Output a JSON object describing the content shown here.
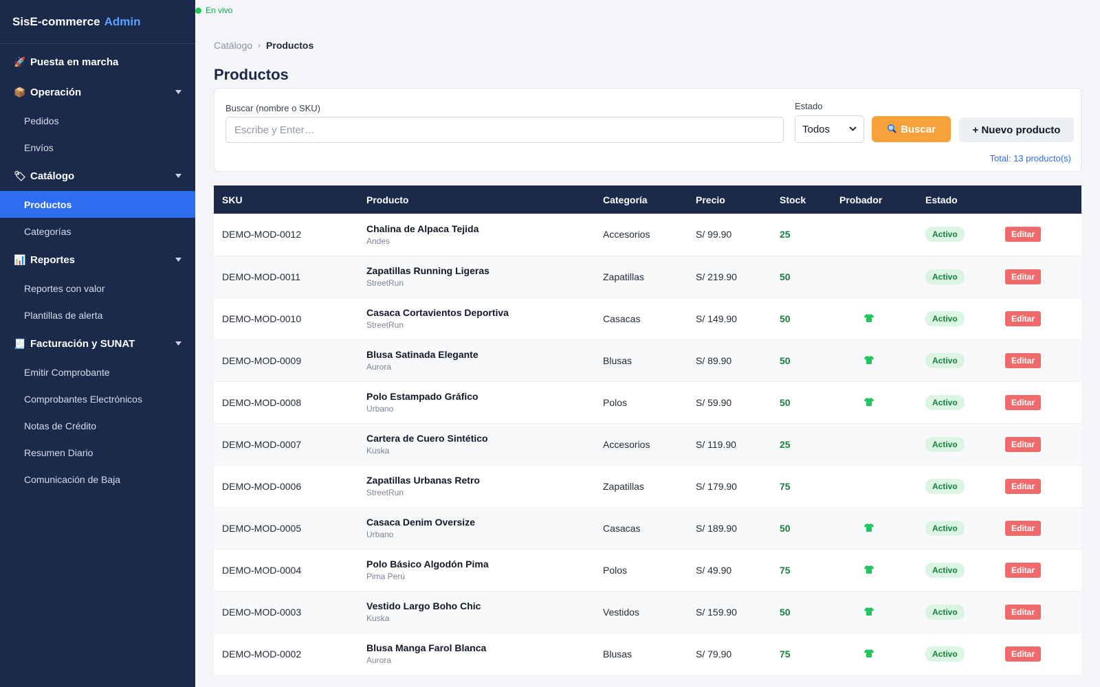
{
  "brand": {
    "name": "SisE-commerce",
    "suffix": "Admin"
  },
  "status": {
    "live": "En vivo"
  },
  "sidebar": {
    "items": [
      {
        "type": "section",
        "label": "Puesta en marcha",
        "icon": "rocket-icon",
        "glyph": "🚀",
        "caret": false
      },
      {
        "type": "section",
        "label": "Operación",
        "icon": "package-icon",
        "glyph": "📦",
        "caret": true
      },
      {
        "type": "item",
        "label": "Pedidos"
      },
      {
        "type": "item",
        "label": "Envíos"
      },
      {
        "type": "section",
        "label": "Catálogo",
        "icon": "tag-icon",
        "glyph": "🏷",
        "caret": true
      },
      {
        "type": "item",
        "label": "Productos",
        "active": true
      },
      {
        "type": "item",
        "label": "Categorías"
      },
      {
        "type": "section",
        "label": "Reportes",
        "icon": "bar-chart-icon",
        "glyph": "📊",
        "caret": true
      },
      {
        "type": "item",
        "label": "Reportes con valor"
      },
      {
        "type": "item",
        "label": "Plantillas de alerta"
      },
      {
        "type": "section",
        "label": "Facturación y SUNAT",
        "icon": "receipt-icon",
        "glyph": "🧾",
        "caret": true
      },
      {
        "type": "item",
        "label": "Emitir Comprobante"
      },
      {
        "type": "item",
        "label": "Comprobantes Electrónicos"
      },
      {
        "type": "item",
        "label": "Notas de Crédito"
      },
      {
        "type": "item",
        "label": "Resumen Diario"
      },
      {
        "type": "item",
        "label": "Comunicación de Baja"
      }
    ]
  },
  "breadcrumb": {
    "parent": "Catálogo",
    "separator": "›",
    "current": "Productos"
  },
  "page": {
    "title": "Productos"
  },
  "filters": {
    "search_label": "Buscar (nombre o SKU)",
    "search_value": "",
    "search_placeholder": "Escribe y Enter…",
    "estado_label": "Estado",
    "estado_value": "Todos",
    "buscar_label": "Buscar",
    "nuevo_label": "+ Nuevo producto",
    "total": "Total: 13 producto(s)"
  },
  "table": {
    "columns": [
      "SKU",
      "Producto",
      "Categoría",
      "Precio",
      "Stock",
      "Probador",
      "Estado",
      ""
    ],
    "rows": [
      {
        "sku": "DEMO-MOD-0012",
        "name": "Chalina de Alpaca Tejida",
        "brand": "Andes",
        "category": "Accesorios",
        "price": "S/ 99.90",
        "stock": "25",
        "probador": false,
        "estado": "Activo",
        "action": "Editar"
      },
      {
        "sku": "DEMO-MOD-0011",
        "name": "Zapatillas Running Ligeras",
        "brand": "StreetRun",
        "category": "Zapatillas",
        "price": "S/ 219.90",
        "stock": "50",
        "probador": false,
        "estado": "Activo",
        "action": "Editar"
      },
      {
        "sku": "DEMO-MOD-0010",
        "name": "Casaca Cortavientos Deportiva",
        "brand": "StreetRun",
        "category": "Casacas",
        "price": "S/ 149.90",
        "stock": "50",
        "probador": true,
        "estado": "Activo",
        "action": "Editar"
      },
      {
        "sku": "DEMO-MOD-0009",
        "name": "Blusa Satinada Elegante",
        "brand": "Aurora",
        "category": "Blusas",
        "price": "S/ 89.90",
        "stock": "50",
        "probador": true,
        "estado": "Activo",
        "action": "Editar"
      },
      {
        "sku": "DEMO-MOD-0008",
        "name": "Polo Estampado Gráfico",
        "brand": "Urbano",
        "category": "Polos",
        "price": "S/ 59.90",
        "stock": "50",
        "probador": true,
        "estado": "Activo",
        "action": "Editar"
      },
      {
        "sku": "DEMO-MOD-0007",
        "name": "Cartera de Cuero Sintético",
        "brand": "Kuska",
        "category": "Accesorios",
        "price": "S/ 119.90",
        "stock": "25",
        "probador": false,
        "estado": "Activo",
        "action": "Editar"
      },
      {
        "sku": "DEMO-MOD-0006",
        "name": "Zapatillas Urbanas Retro",
        "brand": "StreetRun",
        "category": "Zapatillas",
        "price": "S/ 179.90",
        "stock": "75",
        "probador": false,
        "estado": "Activo",
        "action": "Editar"
      },
      {
        "sku": "DEMO-MOD-0005",
        "name": "Casaca Denim Oversize",
        "brand": "Urbano",
        "category": "Casacas",
        "price": "S/ 189.90",
        "stock": "50",
        "probador": true,
        "estado": "Activo",
        "action": "Editar"
      },
      {
        "sku": "DEMO-MOD-0004",
        "name": "Polo Básico Algodón Pima",
        "brand": "Pima Perú",
        "category": "Polos",
        "price": "S/ 49.90",
        "stock": "75",
        "probador": true,
        "estado": "Activo",
        "action": "Editar"
      },
      {
        "sku": "DEMO-MOD-0003",
        "name": "Vestido Largo Boho Chic",
        "brand": "Kuska",
        "category": "Vestidos",
        "price": "S/ 159.90",
        "stock": "50",
        "probador": true,
        "estado": "Activo",
        "action": "Editar"
      },
      {
        "sku": "DEMO-MOD-0002",
        "name": "Blusa Manga Farol Blanca",
        "brand": "Aurora",
        "category": "Blusas",
        "price": "S/ 79.90",
        "stock": "75",
        "probador": true,
        "estado": "Activo",
        "action": "Editar"
      }
    ]
  },
  "colors": {
    "sidebar": "#1b2a4a",
    "accent": "#2c6df1",
    "buscar": "#f6a13a",
    "edit": "#ef6b6b",
    "active_badge": "#dcf5e3"
  }
}
